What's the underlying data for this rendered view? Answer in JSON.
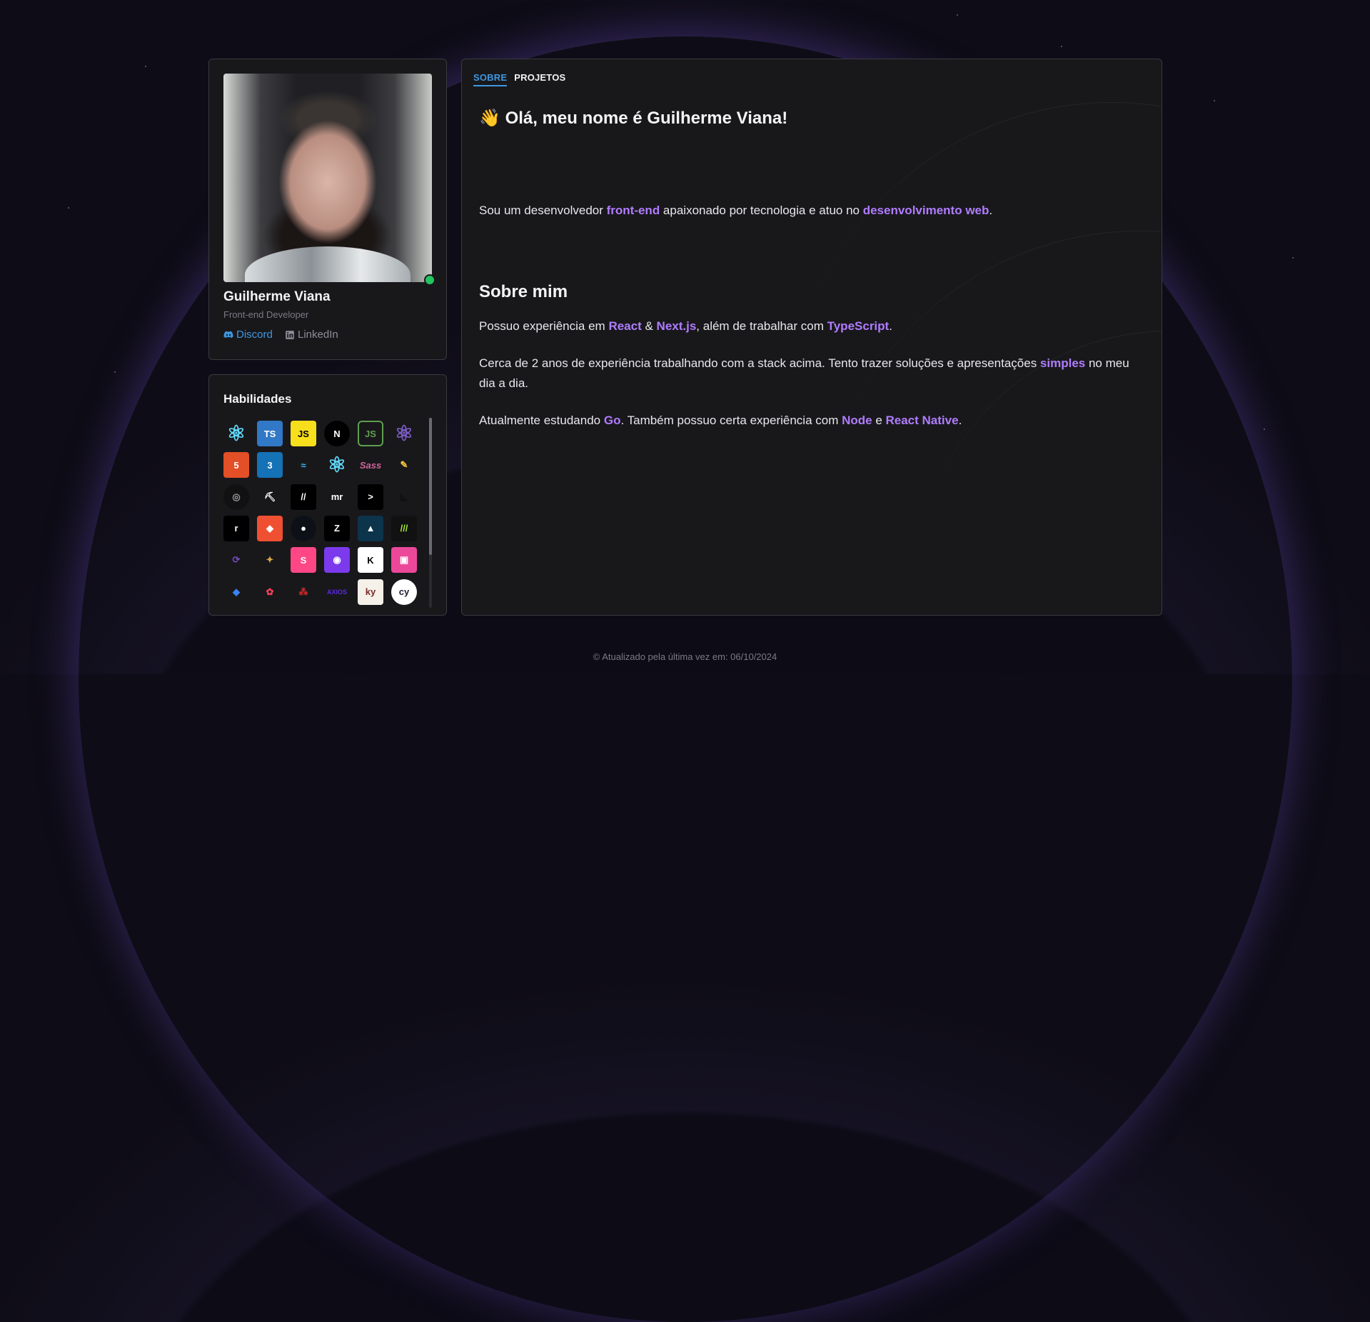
{
  "profile": {
    "name": "Guilherme Viana",
    "role": "Front-end Developer",
    "status": "online",
    "links": [
      {
        "label": "Discord",
        "icon": "discord-icon"
      },
      {
        "label": "LinkedIn",
        "icon": "linkedin-icon"
      }
    ]
  },
  "skills": {
    "title": "Habilidades",
    "items": [
      {
        "name": "react",
        "glyph": "⚛",
        "color": "#61dafb",
        "bg": "transparent"
      },
      {
        "name": "typescript",
        "glyph": "TS",
        "color": "#ffffff",
        "bg": "#3178c6"
      },
      {
        "name": "javascript",
        "glyph": "JS",
        "color": "#000000",
        "bg": "#f7df1e"
      },
      {
        "name": "nextjs",
        "glyph": "N",
        "color": "#ffffff",
        "bg": "#000000"
      },
      {
        "name": "nodejs",
        "glyph": "JS",
        "color": "#5fa04e",
        "bg": "transparent"
      },
      {
        "name": "react-purple",
        "glyph": "⚛",
        "color": "#7c5cc4",
        "bg": "transparent"
      },
      {
        "name": "html5",
        "glyph": "5",
        "color": "#ffffff",
        "bg": "#e34f26"
      },
      {
        "name": "css3",
        "glyph": "3",
        "color": "#ffffff",
        "bg": "#1572b6"
      },
      {
        "name": "tailwindcss",
        "glyph": "≈",
        "color": "#38bdf8",
        "bg": "transparent"
      },
      {
        "name": "react-native",
        "glyph": "⚛",
        "color": "#61dafb",
        "bg": "transparent"
      },
      {
        "name": "sass",
        "glyph": "Sass",
        "color": "#cc6699",
        "bg": "transparent"
      },
      {
        "name": "pencil",
        "glyph": "✎",
        "color": "#f5c542",
        "bg": "transparent"
      },
      {
        "name": "stitches",
        "glyph": "◎",
        "color": "#9a9aa2",
        "bg": "#111111"
      },
      {
        "name": "pickaxe",
        "glyph": "⛏",
        "color": "#ffffff",
        "bg": "transparent"
      },
      {
        "name": "shadcn",
        "glyph": "//",
        "color": "#ffffff",
        "bg": "#000000"
      },
      {
        "name": "mr",
        "glyph": "mr",
        "color": "#ffffff",
        "bg": "transparent"
      },
      {
        "name": "arrow",
        "glyph": ">",
        "color": "#ffffff",
        "bg": "#000000"
      },
      {
        "name": "framer",
        "glyph": "◣",
        "color": "#111111",
        "bg": "transparent"
      },
      {
        "name": "radix",
        "glyph": "r",
        "color": "#ffffff",
        "bg": "#000000"
      },
      {
        "name": "git",
        "glyph": "◆",
        "color": "#ffffff",
        "bg": "#f05032"
      },
      {
        "name": "github",
        "glyph": "●",
        "color": "#ffffff",
        "bg": "#0d1117"
      },
      {
        "name": "zod",
        "glyph": "Z",
        "color": "#ffffff",
        "bg": "#000000"
      },
      {
        "name": "prisma",
        "glyph": "▲",
        "color": "#ffffff",
        "bg": "#0c344b"
      },
      {
        "name": "vitest",
        "glyph": "///",
        "color": "#a3e635",
        "bg": "#111111"
      },
      {
        "name": "redux",
        "glyph": "⟳",
        "color": "#764abc",
        "bg": "transparent"
      },
      {
        "name": "bird",
        "glyph": "✦",
        "color": "#d9a64a",
        "bg": "transparent"
      },
      {
        "name": "storybook",
        "glyph": "S",
        "color": "#ffffff",
        "bg": "#ff4785"
      },
      {
        "name": "shield",
        "glyph": "◉",
        "color": "#ffffff",
        "bg": "#7c3aed"
      },
      {
        "name": "knex",
        "glyph": "K",
        "color": "#000000",
        "bg": "#ffffff"
      },
      {
        "name": "clipboard",
        "glyph": "▣",
        "color": "#ffffff",
        "bg": "#ec4899"
      },
      {
        "name": "gem",
        "glyph": "◆",
        "color": "#3b82f6",
        "bg": "transparent"
      },
      {
        "name": "flower",
        "glyph": "✿",
        "color": "#f43f5e",
        "bg": "transparent"
      },
      {
        "name": "dots",
        "glyph": "⁂",
        "color": "#dc2626",
        "bg": "transparent"
      },
      {
        "name": "axios",
        "glyph": "AXIOS",
        "color": "#5a29e4",
        "bg": "transparent"
      },
      {
        "name": "ky",
        "glyph": "ky",
        "color": "#7a2a2a",
        "bg": "#f5f0e8"
      },
      {
        "name": "cypress",
        "glyph": "cy",
        "color": "#1b1e2e",
        "bg": "#ffffff"
      }
    ]
  },
  "tabs": [
    {
      "label": "SOBRE",
      "active": true
    },
    {
      "label": "PROJETOS",
      "active": false
    }
  ],
  "about": {
    "greeting_emoji": "👋",
    "greeting": "Olá, meu nome é Guilherme Viana!",
    "intro": {
      "t1": "Sou um desenvolvedor ",
      "h1": "front-end",
      "t2": " apaixonado por tecnologia e atuo no ",
      "h2": "desenvolvimento web",
      "t3": "."
    },
    "section_title": "Sobre mim",
    "p1": {
      "t1": "Possuo experiência em ",
      "h1": "React",
      "t2": " & ",
      "h2": "Next.js",
      "t3": ", além de trabalhar com ",
      "h3": "TypeScript",
      "t4": "."
    },
    "p2": {
      "t1": "Cerca de 2 anos de experiência trabalhando com a stack acima. Tento trazer soluções e apresentações ",
      "h1": "simples",
      "t2": " no meu dia a dia."
    },
    "p3": {
      "t1": "Atualmente estudando ",
      "h1": "Go",
      "t2": ". Também possuo certa experiência com ",
      "h2": "Node",
      "t3": " e ",
      "h3": "React Native",
      "t4": "."
    }
  },
  "footer": {
    "text": "© Atualizado pela última vez em: 06/10/2024"
  },
  "colors": {
    "accent_blue": "#3f97e0",
    "highlight_purple": "#b07cff",
    "status_online": "#22c55e",
    "card_bg": "#18181b"
  }
}
